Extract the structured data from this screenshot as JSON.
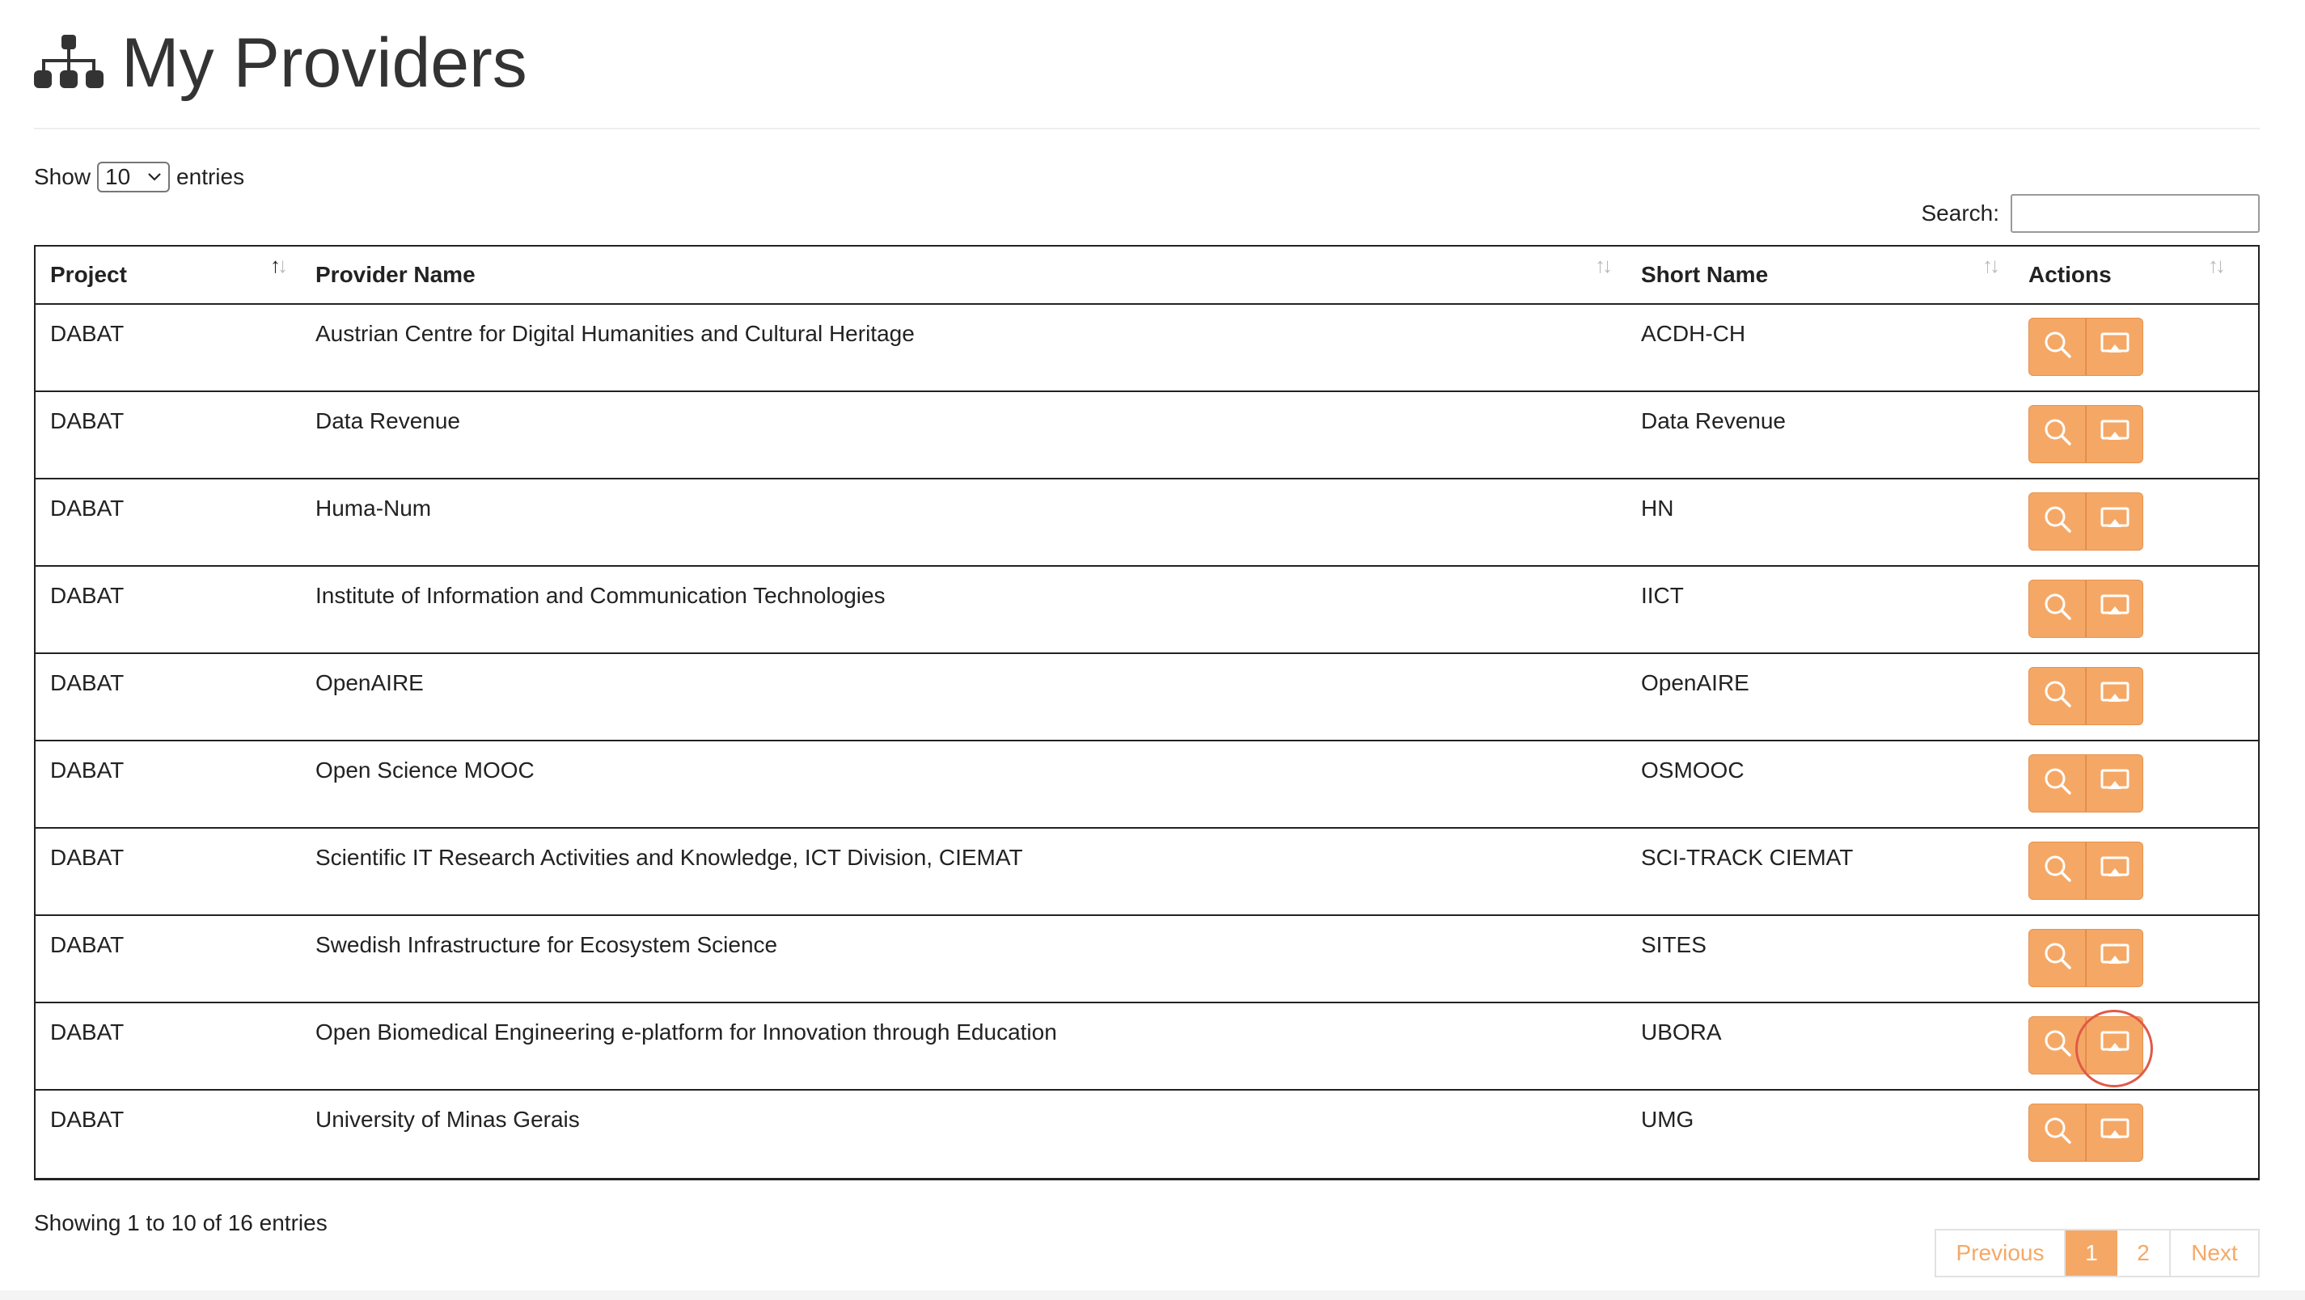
{
  "page": {
    "title": "My Providers",
    "title_icon": "sitemap-icon"
  },
  "length": {
    "prefix": "Show",
    "value": "10",
    "suffix": "entries"
  },
  "search": {
    "label": "Search:",
    "value": ""
  },
  "table": {
    "columns": [
      {
        "label": "Project",
        "sort": "asc"
      },
      {
        "label": "Provider Name",
        "sort": "none"
      },
      {
        "label": "Short Name",
        "sort": "none"
      },
      {
        "label": "Actions",
        "sort": "none"
      }
    ],
    "rows": [
      {
        "project": "DABAT",
        "name": "Austrian Centre for Digital Humanities and Cultural Heritage",
        "short": "ACDH-CH"
      },
      {
        "project": "DABAT",
        "name": "Data Revenue",
        "short": "Data Revenue"
      },
      {
        "project": "DABAT",
        "name": "Huma-Num",
        "short": "HN"
      },
      {
        "project": "DABAT",
        "name": "Institute of Information and Communication Technologies",
        "short": "IICT"
      },
      {
        "project": "DABAT",
        "name": "OpenAIRE",
        "short": "OpenAIRE"
      },
      {
        "project": "DABAT",
        "name": "Open Science MOOC",
        "short": "OSMOOC"
      },
      {
        "project": "DABAT",
        "name": "Scientific IT Research Activities and Knowledge, ICT Division, CIEMAT",
        "short": "SCI-TRACK CIEMAT"
      },
      {
        "project": "DABAT",
        "name": "Swedish Infrastructure for Ecosystem Science",
        "short": "SITES"
      },
      {
        "project": "DABAT",
        "name": "Open Biomedical Engineering e-platform for Innovation through Education",
        "short": "UBORA"
      },
      {
        "project": "DABAT",
        "name": "University of Minas Gerais",
        "short": "UMG"
      }
    ],
    "actions": [
      "search-icon",
      "presentation-icon"
    ]
  },
  "footer": {
    "info": "Showing 1 to 10 of 16 entries",
    "pagination": {
      "previous": "Previous",
      "pages": [
        "1",
        "2"
      ],
      "current": "1",
      "next": "Next"
    }
  },
  "colors": {
    "accent": "#f5a866",
    "highlight_ring": "#e05a47"
  }
}
